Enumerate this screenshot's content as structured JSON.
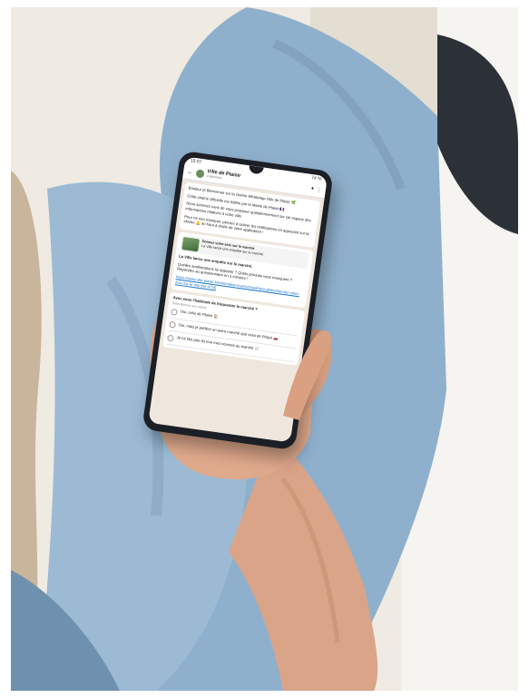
{
  "photo": {
    "subject": "",
    "accent_color": "#1f8a4c"
  },
  "phone": {
    "status": {
      "time": "15:07",
      "battery": "74 %"
    },
    "header": {
      "title": "Ville de Plaisir",
      "subtitle": "4 abonnés",
      "back_glyph": "←",
      "icons": [
        "bell-icon",
        "more-icon"
      ]
    },
    "messages": [
      "Bonjour et Bienvenue sur la chaîne WhatsApp Ville de Plaisir 🌿",
      "Cette chaîne officielle est éditée par la Mairie de Plaisir 🇫🇷",
      "Nous sommes ravis de vous proposer quotidiennement sur cet espace des informations relatives à votre ville.",
      "Pour ne rien manquer, pensez à activer les notifications en appuyant sur la cloche 🔔 en haut à droite de votre application !"
    ],
    "card": {
      "title": "Donnez votre avis sur le marché",
      "subtitle": "La Ville lance une enquête sur le marché"
    },
    "post": {
      "text1": "La Ville lance une enquête sur le marché.",
      "text2": "Quelles améliorations lui apporter ? Quels produits vous manquent ? Répondez au questionnaire en 3 minutes !",
      "link": "https://www.ville-plaisir.fr/information-transversale/actualites/donnez-votre-avis-sur-le-marche-4736"
    },
    "poll": {
      "question": "Avez-vous l'habitude de fréquenter le marché ?",
      "hint": "Sélectionnez une option",
      "options": [
        "Oui, celui de Plaisir 🏠",
        "Oui, mais je préfère un autre marché que celui de Plaisir 🚗",
        "Je ne fais pas du tout mes courses au marché 🛒"
      ]
    }
  }
}
